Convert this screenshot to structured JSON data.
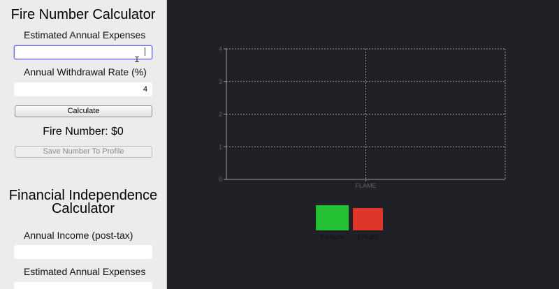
{
  "sidebar": {
    "fire_title": "Fire Number Calculator",
    "expenses_label": "Estimated Annual Expenses",
    "expenses_value": "",
    "withdrawal_label": "Annual Withdrawal Rate (%)",
    "withdrawal_value": "4",
    "calculate_label": "Calculate",
    "fire_number_text": "Fire Number: $0",
    "save_label": "Save Number To Profile",
    "fi_title_line1": "Financial Independence",
    "fi_title_line2": "Calculator",
    "income_label": "Annual Income (post-tax)",
    "income_value": "",
    "fi_expenses_label": "Estimated Annual Expenses"
  },
  "chart_data": {
    "type": "bar",
    "categories": [
      "FLAME"
    ],
    "series": [
      {
        "name": "fireNum",
        "values": [
          0
        ],
        "color": "#22c032"
      },
      {
        "name": "fiYears",
        "values": [
          0
        ],
        "color": "#e0362a"
      }
    ],
    "ylim": [
      0,
      4
    ],
    "yticks": [
      "0",
      "1",
      "2",
      "3",
      "4"
    ],
    "grid": true,
    "legend": "bottom",
    "colors": {
      "background": "#1f2127",
      "grid": "#9a9ca4",
      "ticks": "#5e6068"
    }
  }
}
